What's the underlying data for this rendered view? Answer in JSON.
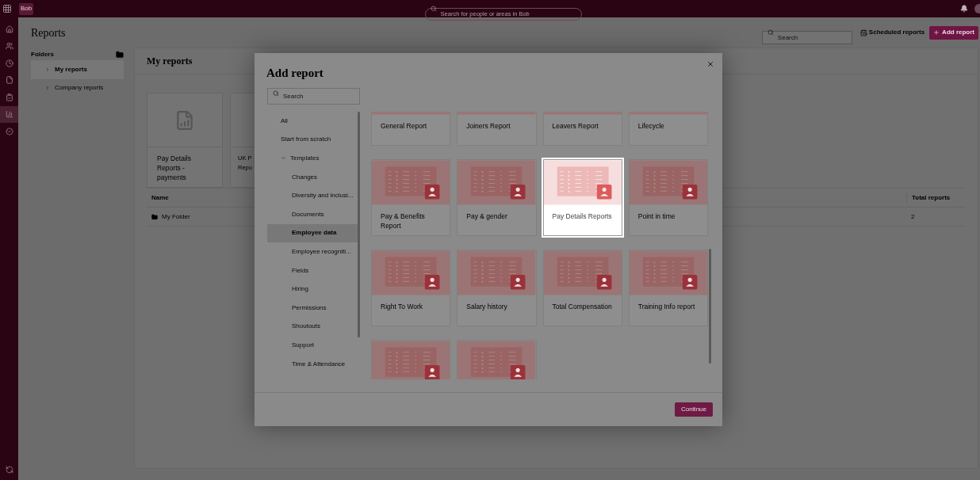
{
  "top_bar": {
    "logo": "Bob",
    "search": {
      "placeholder": "Search for people or areas in Bob"
    }
  },
  "nav_rail": [
    {
      "selected": false
    },
    {
      "selected": false
    },
    {
      "selected": false
    },
    {
      "selected": false
    },
    {
      "selected": false
    },
    {
      "selected": true
    },
    {
      "selected": false
    }
  ],
  "header": {
    "title": "Reports",
    "search": {
      "placeholder": "Search"
    },
    "scheduled_button": "Scheduled reports",
    "add_button": "Add report"
  },
  "folders": {
    "title": "Folders",
    "items": [
      {
        "label": "My reports",
        "selected": true
      },
      {
        "label": "Company reports",
        "selected": false
      }
    ]
  },
  "content": {
    "title": "My reports",
    "cards": [
      {
        "lines": [
          "Pay Details",
          "Reports -",
          "payments"
        ]
      },
      {
        "lines": [
          "UK P",
          "Repo"
        ]
      }
    ],
    "table": {
      "columns": [
        "Name",
        "Total reports"
      ],
      "rows": [
        {
          "name": "My Folder",
          "total": "2"
        }
      ]
    }
  },
  "modal": {
    "title": "Add report",
    "search": {
      "placeholder": "Search"
    },
    "categories": [
      {
        "label": "All",
        "selected": false
      },
      {
        "label": "Start from scratch",
        "selected": false
      },
      {
        "label": "Templates",
        "selected": false,
        "expanded": true,
        "children": [
          {
            "label": "Changes",
            "selected": false
          },
          {
            "label": "Diversity and inclusi...",
            "selected": false
          },
          {
            "label": "Documents",
            "selected": false
          },
          {
            "label": "Employee data",
            "selected": true
          },
          {
            "label": "Employee recogniti...",
            "selected": false
          },
          {
            "label": "Fields",
            "selected": false
          },
          {
            "label": "Hiring",
            "selected": false
          },
          {
            "label": "Permissions",
            "selected": false
          },
          {
            "label": "Shoutouts",
            "selected": false
          },
          {
            "label": "Support",
            "selected": false
          },
          {
            "label": "Time & Attendance",
            "selected": false
          }
        ]
      }
    ],
    "templates": [
      {
        "title": "General Report",
        "selected": false
      },
      {
        "title": "Joiners Report",
        "selected": false
      },
      {
        "title": "Leavers Report",
        "selected": false
      },
      {
        "title": "Lifecycle",
        "selected": false
      },
      {
        "title": "Pay & Benefits Report",
        "selected": false
      },
      {
        "title": "Pay & gender",
        "selected": false
      },
      {
        "title": "Pay Details Reports",
        "selected": true
      },
      {
        "title": "Point in time",
        "selected": false
      },
      {
        "title": "Right To Work",
        "selected": false
      },
      {
        "title": "Salary history",
        "selected": false
      },
      {
        "title": "Total Compensation",
        "selected": false
      },
      {
        "title": "Training Info report",
        "selected": false
      },
      {
        "selected": false
      },
      {
        "selected": false
      }
    ],
    "continue_button": "Continue"
  }
}
